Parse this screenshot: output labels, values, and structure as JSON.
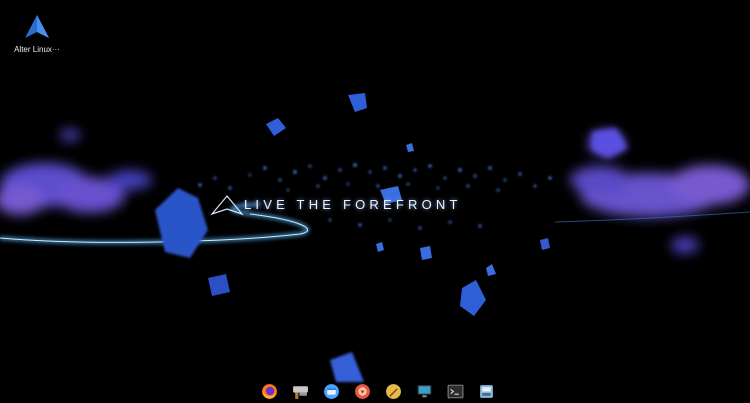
{
  "screen": {
    "background": "#000000"
  },
  "desktop_icons": [
    {
      "label": "Alter Linux···",
      "icon": "alter-linux-logo-icon",
      "color": "#3a7bd5"
    }
  ],
  "wallpaper": {
    "slogan": "LIVE THE FOREFRONT",
    "logo": "alter-linux-logo-icon",
    "accent_colors": [
      "#3a4fd8",
      "#6a5bf0",
      "#48b4ff",
      "#1f5fd6"
    ]
  },
  "dock": {
    "items": [
      {
        "name": "firefox",
        "icon": "firefox-icon",
        "color": "#ff7a18"
      },
      {
        "name": "mousepad",
        "icon": "text-editor-icon",
        "color": "#c8c8c8"
      },
      {
        "name": "file-manager",
        "icon": "file-manager-icon",
        "color": "#4aa3ff"
      },
      {
        "name": "software-installer",
        "icon": "package-installer-icon",
        "color": "#e8563a"
      },
      {
        "name": "settings",
        "icon": "settings-brush-icon",
        "color": "#e8b84a"
      },
      {
        "name": "display-settings",
        "icon": "monitor-icon",
        "color": "#3aa0c8"
      },
      {
        "name": "terminal",
        "icon": "terminal-icon",
        "color": "#2d2d2d"
      },
      {
        "name": "install-system",
        "icon": "installer-icon",
        "color": "#8fb8d8"
      }
    ]
  }
}
